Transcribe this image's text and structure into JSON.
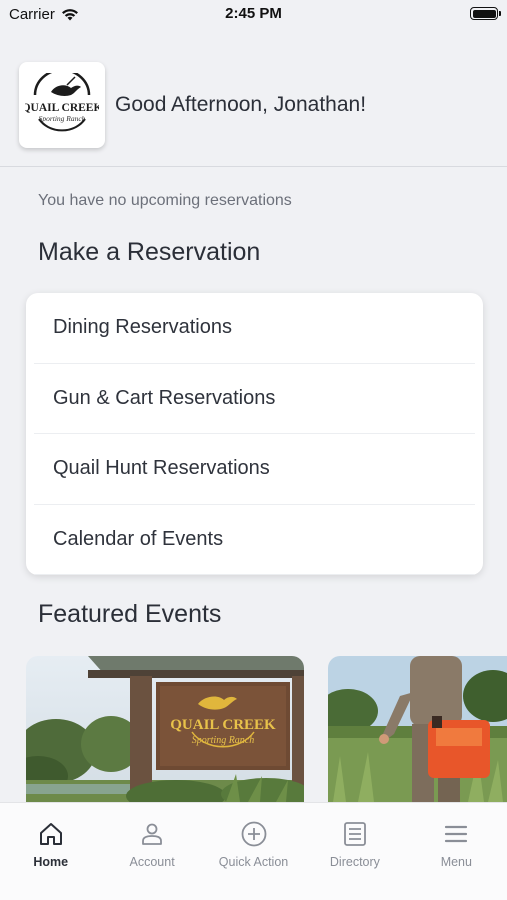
{
  "status_bar": {
    "carrier": "Carrier",
    "time": "2:45 PM"
  },
  "header": {
    "logo_title": "QUAIL CREEK",
    "logo_subtitle": "Sporting Ranch",
    "greeting": "Good Afternoon, Jonathan!"
  },
  "reservations_note": "You have no upcoming reservations",
  "make_reservation": {
    "title": "Make a Reservation",
    "items": [
      {
        "label": "Dining Reservations"
      },
      {
        "label": "Gun & Cart Reservations"
      },
      {
        "label": "Quail Hunt Reservations"
      },
      {
        "label": "Calendar of Events"
      }
    ]
  },
  "featured": {
    "title": "Featured Events",
    "sign_title": "QUAIL CREEK",
    "sign_subtitle": "Sporting Ranch"
  },
  "tabbar": {
    "items": [
      {
        "label": "Home",
        "icon": "home-icon"
      },
      {
        "label": "Account",
        "icon": "person-icon"
      },
      {
        "label": "Quick Action",
        "icon": "plus-circle-icon"
      },
      {
        "label": "Directory",
        "icon": "directory-icon"
      },
      {
        "label": "Menu",
        "icon": "hamburger-icon"
      }
    ]
  },
  "colors": {
    "background": "#f0f1f4",
    "text": "#2b2f38",
    "muted": "#8a8e97"
  }
}
